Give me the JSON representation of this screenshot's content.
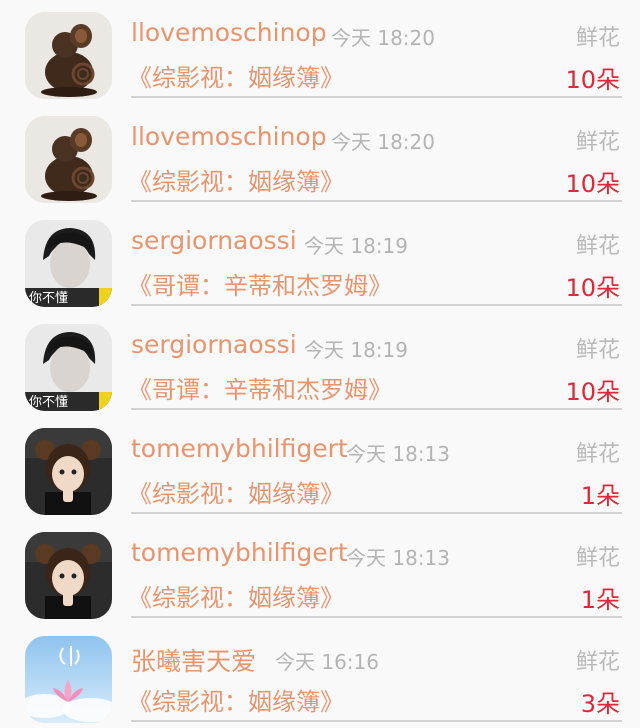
{
  "gifts": [
    {
      "user": "llovemoschinop",
      "time": "今天 18:20",
      "gift": "鲜花",
      "show": "《综影视：姻缘簿》",
      "count": "10朵",
      "avatar": "carved-mouse-avatar"
    },
    {
      "user": "llovemoschinop",
      "time": "今天 18:20",
      "gift": "鲜花",
      "show": "《综影视：姻缘簿》",
      "count": "10朵",
      "avatar": "carved-mouse-avatar"
    },
    {
      "user": "sergiornaossi",
      "time": "今天 18:19",
      "gift": "鲜花",
      "show": "《哥谭：辛蒂和杰罗姆》",
      "count": "10朵",
      "avatar": "boy-portrait-avatar",
      "avatar_caption": "你不懂"
    },
    {
      "user": "sergiornaossi",
      "time": "今天 18:19",
      "gift": "鲜花",
      "show": "《哥谭：辛蒂和杰罗姆》",
      "count": "10朵",
      "avatar": "boy-portrait-avatar",
      "avatar_caption": "你不懂"
    },
    {
      "user": "tomemybhilfigert",
      "time": "今天 18:13",
      "gift": "鲜花",
      "show": "《综影视：姻缘簿》",
      "count": "1朵",
      "avatar": "little-girl-avatar"
    },
    {
      "user": "tomemybhilfigert",
      "time": "今天 18:13",
      "gift": "鲜花",
      "show": "《综影视：姻缘簿》",
      "count": "1朵",
      "avatar": "little-girl-avatar"
    },
    {
      "user": "张曦害天爱",
      "time": "今天 16:16",
      "gift": "鲜花",
      "show": "《综影视：姻缘簿》",
      "count": "3朵",
      "avatar": "lotus-sky-avatar"
    }
  ],
  "colors": {
    "name": "#e8956e",
    "count": "#e0273a",
    "muted": "#b4b4b4",
    "divider": "#d2d2d2"
  }
}
